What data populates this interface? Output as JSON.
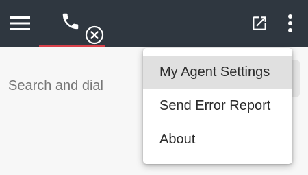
{
  "topbar": {
    "icons": {
      "menu": "hamburger-menu-icon",
      "phone": "phone-icon",
      "status": "circle-x-icon",
      "popout": "open-in-new-icon",
      "more": "more-vertical-icon"
    },
    "colors": {
      "background": "#2f3740",
      "tab_underline": "#d8404a",
      "icon": "#ffffff"
    }
  },
  "search": {
    "placeholder": "Search and dial",
    "value": ""
  },
  "menu": {
    "items": [
      {
        "label": "My Agent Settings",
        "highlighted": true
      },
      {
        "label": "Send Error Report",
        "highlighted": false
      },
      {
        "label": "About",
        "highlighted": false
      }
    ]
  }
}
